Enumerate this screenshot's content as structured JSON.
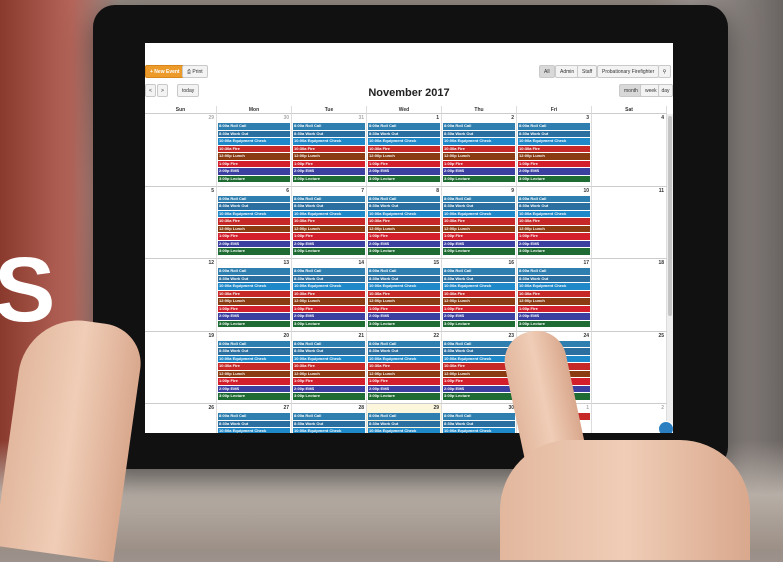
{
  "background": {
    "letter": "S"
  },
  "toolbar": {
    "new_event": "+ New Event",
    "print": "Print",
    "print_icon": "printer-icon",
    "filters": [
      "All",
      "Admin",
      "Staff",
      "Probationary Firefighter"
    ],
    "search_icon": "search-icon",
    "prev": "<",
    "next": ">",
    "today": "today",
    "views": [
      "month",
      "week",
      "day"
    ],
    "active_view": "month"
  },
  "calendar": {
    "title": "November 2017",
    "weekdays": [
      "Sun",
      "Mon",
      "Tue",
      "Wed",
      "Thu",
      "Fri",
      "Sat"
    ],
    "weeks": [
      [
        {
          "n": "29",
          "o": true
        },
        {
          "n": "30",
          "o": true
        },
        {
          "n": "31",
          "o": true
        },
        {
          "n": "1"
        },
        {
          "n": "2"
        },
        {
          "n": "3"
        },
        {
          "n": "4"
        }
      ],
      [
        {
          "n": "5"
        },
        {
          "n": "6"
        },
        {
          "n": "7"
        },
        {
          "n": "8"
        },
        {
          "n": "9"
        },
        {
          "n": "10"
        },
        {
          "n": "11"
        }
      ],
      [
        {
          "n": "12"
        },
        {
          "n": "13"
        },
        {
          "n": "14"
        },
        {
          "n": "15"
        },
        {
          "n": "16"
        },
        {
          "n": "17"
        },
        {
          "n": "18"
        }
      ],
      [
        {
          "n": "19"
        },
        {
          "n": "20"
        },
        {
          "n": "21"
        },
        {
          "n": "22"
        },
        {
          "n": "23"
        },
        {
          "n": "24"
        },
        {
          "n": "25"
        }
      ],
      [
        {
          "n": "26"
        },
        {
          "n": "27"
        },
        {
          "n": "28"
        },
        {
          "n": "29"
        },
        {
          "n": "30"
        },
        {
          "n": "1",
          "o": true
        },
        {
          "n": "2",
          "o": true
        }
      ]
    ],
    "today": "29",
    "events": [
      {
        "label": "8:00a Roll Call",
        "color": "#2e7fb0"
      },
      {
        "label": "8:30a Work Out",
        "color": "#2a6fa0"
      },
      {
        "label": "10:00a Equipment Check",
        "color": "#1e88c9"
      },
      {
        "label": "10:30a Fire",
        "color": "#c62828"
      },
      {
        "label": "12:00p Lunch",
        "color": "#8a3b12"
      },
      {
        "label": "1:00p Fire",
        "color": "#d21f2b"
      },
      {
        "label": "2:00p EMS",
        "color": "#3b3fa0"
      },
      {
        "label": "3:00p Lecture",
        "color": "#1e6b33"
      }
    ],
    "extra_event": {
      "label": "10:30a Fire",
      "color": "#c62828"
    },
    "event_days": "Mon-Fri"
  },
  "colors": {
    "accent": "#ec9a2a",
    "tablet": "#111111"
  }
}
